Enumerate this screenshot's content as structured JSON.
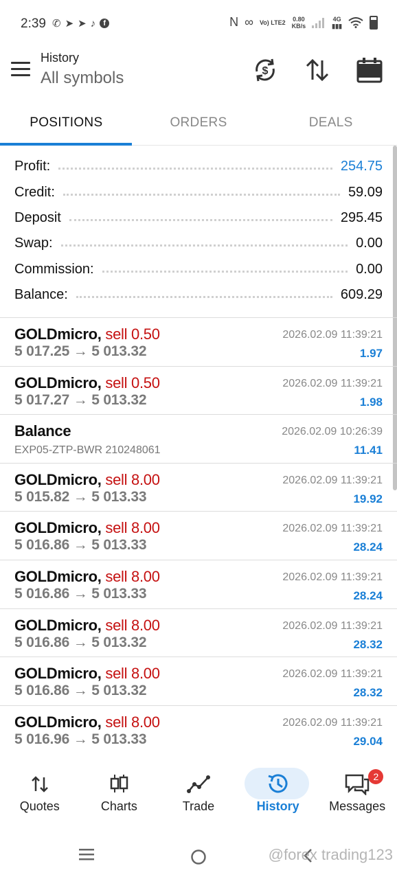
{
  "status_bar": {
    "time": "2:39",
    "left_icons": [
      "whatsapp-icon",
      "telegram-icon",
      "telegram-icon",
      "tiktok-icon",
      "facebook-icon"
    ],
    "right_icons": [
      "nfc-icon",
      "link-icon",
      "volte-icon",
      "net-speed-icon",
      "signal-icon",
      "4g-signal-icon",
      "wifi-icon",
      "battery-icon"
    ],
    "volte_label": "Vo) LTE2",
    "speed_value": "0.80",
    "speed_unit": "KB/s",
    "net_label": "4G"
  },
  "header": {
    "title": "History",
    "subtitle": "All symbols",
    "actions": [
      "currency-exchange-icon",
      "sort-icon",
      "calendar-icon"
    ]
  },
  "tabs": [
    {
      "label": "POSITIONS",
      "active": true
    },
    {
      "label": "ORDERS",
      "active": false
    },
    {
      "label": "DEALS",
      "active": false
    }
  ],
  "summary": [
    {
      "label": "Profit:",
      "value": "254.75",
      "color": "#1a7fd6"
    },
    {
      "label": "Credit:",
      "value": "59.09"
    },
    {
      "label": "Deposit",
      "value": "295.45"
    },
    {
      "label": "Swap:",
      "value": "0.00"
    },
    {
      "label": "Commission:",
      "value": "0.00"
    },
    {
      "label": "Balance:",
      "value": "609.29"
    }
  ],
  "deals": [
    {
      "symbol": "GOLDmicro,",
      "type": "sell 0.50",
      "prices": "5 017.25 → 5 013.32",
      "time": "2026.02.09 11:39:21",
      "profit": "1.97"
    },
    {
      "symbol": "GOLDmicro,",
      "type": "sell 0.50",
      "prices": "5 017.27 → 5 013.32",
      "time": "2026.02.09 11:39:21",
      "profit": "1.98"
    },
    {
      "symbol": "Balance",
      "comment": "EXP05-ZTP-BWR 210248061",
      "time": "2026.02.09 10:26:39",
      "profit": "11.41"
    },
    {
      "symbol": "GOLDmicro,",
      "type": "sell 8.00",
      "prices": "5 015.82 → 5 013.33",
      "time": "2026.02.09 11:39:21",
      "profit": "19.92"
    },
    {
      "symbol": "GOLDmicro,",
      "type": "sell 8.00",
      "prices": "5 016.86 → 5 013.33",
      "time": "2026.02.09 11:39:21",
      "profit": "28.24"
    },
    {
      "symbol": "GOLDmicro,",
      "type": "sell 8.00",
      "prices": "5 016.86 → 5 013.33",
      "time": "2026.02.09 11:39:21",
      "profit": "28.24"
    },
    {
      "symbol": "GOLDmicro,",
      "type": "sell 8.00",
      "prices": "5 016.86 → 5 013.32",
      "time": "2026.02.09 11:39:21",
      "profit": "28.32"
    },
    {
      "symbol": "GOLDmicro,",
      "type": "sell 8.00",
      "prices": "5 016.86 → 5 013.32",
      "time": "2026.02.09 11:39:21",
      "profit": "28.32"
    },
    {
      "symbol": "GOLDmicro,",
      "type": "sell 8.00",
      "prices": "5 016.96 → 5 013.33",
      "time": "2026.02.09 11:39:21",
      "profit": "29.04"
    }
  ],
  "bottom_nav": [
    {
      "label": "Quotes",
      "icon": "quotes-arrows-icon"
    },
    {
      "label": "Charts",
      "icon": "candlestick-icon"
    },
    {
      "label": "Trade",
      "icon": "trade-line-icon"
    },
    {
      "label": "History",
      "icon": "history-clock-icon",
      "active": true
    },
    {
      "label": "Messages",
      "icon": "messages-icon",
      "badge": "2"
    }
  ],
  "system_nav": [
    "recent-apps-icon",
    "home-icon",
    "back-icon"
  ],
  "watermark": "@forex trading123",
  "colors": {
    "accent": "#1a7fd6",
    "sell": "#c51111",
    "badge": "#e53935"
  }
}
